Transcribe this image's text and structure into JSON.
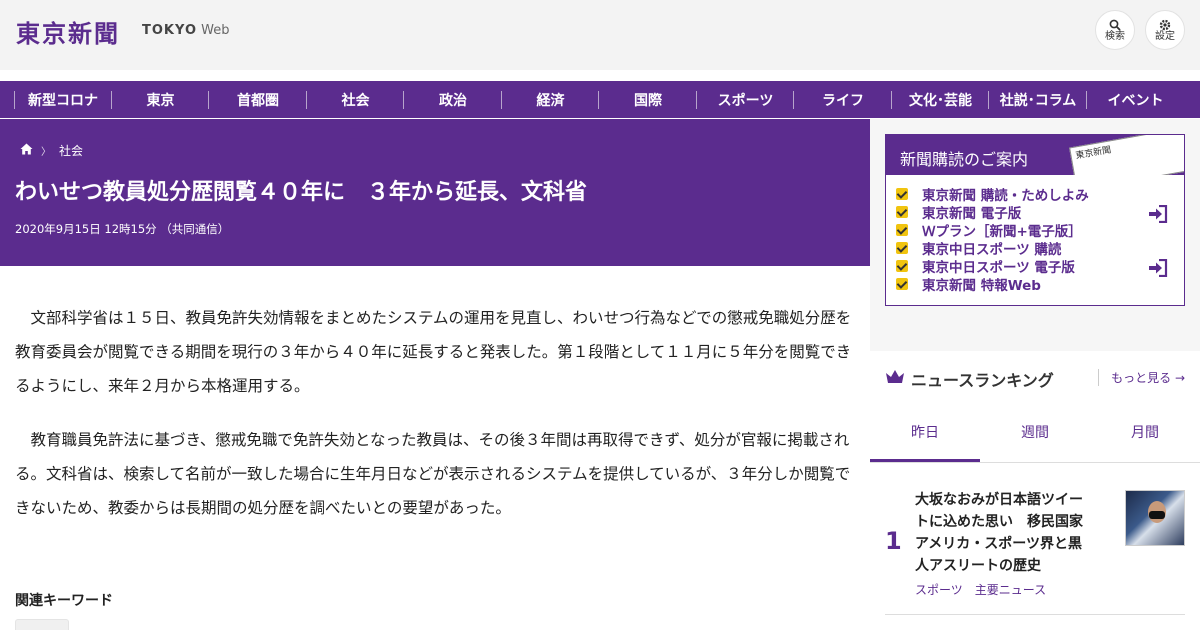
{
  "header": {
    "logo_jp": "東京新聞",
    "logo_en_bold": "TOKYO",
    "logo_en_light": "Web",
    "search_label": "検索",
    "settings_label": "設定"
  },
  "nav": {
    "items": [
      {
        "label": "新型コロナ"
      },
      {
        "label": "東京"
      },
      {
        "label": "首都圏"
      },
      {
        "label": "社会"
      },
      {
        "label": "政治"
      },
      {
        "label": "経済"
      },
      {
        "label": "国際"
      },
      {
        "label": "スポーツ"
      },
      {
        "label": "ライフ"
      },
      {
        "label": "文化･芸能"
      },
      {
        "label": "社説･コラム"
      },
      {
        "label": "イベント"
      }
    ]
  },
  "article": {
    "breadcrumb_section": "社会",
    "breadcrumb_sep": "〉",
    "headline": "わいせつ教員処分歴閲覧４０年に　３年から延長、文科省",
    "dateline": "2020年9月15日 12時15分 （共同通信）",
    "paragraphs": [
      "文部科学省は１５日、教員免許失効情報をまとめたシステムの運用を見直し、わいせつ行為などでの懲戒免職処分歴を教育委員会が閲覧できる期間を現行の３年から４０年に延長すると発表した。第１段階として１１月に５年分を閲覧できるようにし、来年２月から本格運用する。",
      "教育職員免許法に基づき、懲戒免職で免許失効となった教員は、その後３年間は再取得できず、処分が官報に掲載される。文科省は、検索して名前が一致した場合に生年月日などが表示されるシステムを提供しているが、３年分しか閲覧できないため、教委からは長期間の処分歴を調べたいとの要望があった。"
    ],
    "keywords_title": "関連キーワード"
  },
  "subscription": {
    "title": "新聞購読のご案内",
    "newspaper_text": "東京新聞",
    "items": [
      {
        "label": "東京新聞 購読・ためしよみ"
      },
      {
        "label": "東京新聞 電子版"
      },
      {
        "label": "Ｗプラン［新聞+電子版］"
      },
      {
        "label": "東京中日スポーツ 購読"
      },
      {
        "label": "東京中日スポーツ 電子版"
      },
      {
        "label": "東京新聞 特報Web"
      }
    ]
  },
  "ranking": {
    "title": "ニュースランキング",
    "more_label": "もっと見る",
    "tabs": [
      {
        "label": "昨日"
      },
      {
        "label": "週間"
      },
      {
        "label": "月間"
      }
    ],
    "items": [
      {
        "rank": "1",
        "title": "大坂なおみが日本語ツイートに込めた思い　移民国家アメリカ・スポーツ界と黒人アスリートの歴史",
        "tags": [
          "スポーツ",
          "主要ニュース"
        ]
      }
    ]
  },
  "colors": {
    "brand_purple": "#5b2c8e",
    "check_yellow": "#f1c40f",
    "header_gray": "#f3f3f3"
  }
}
